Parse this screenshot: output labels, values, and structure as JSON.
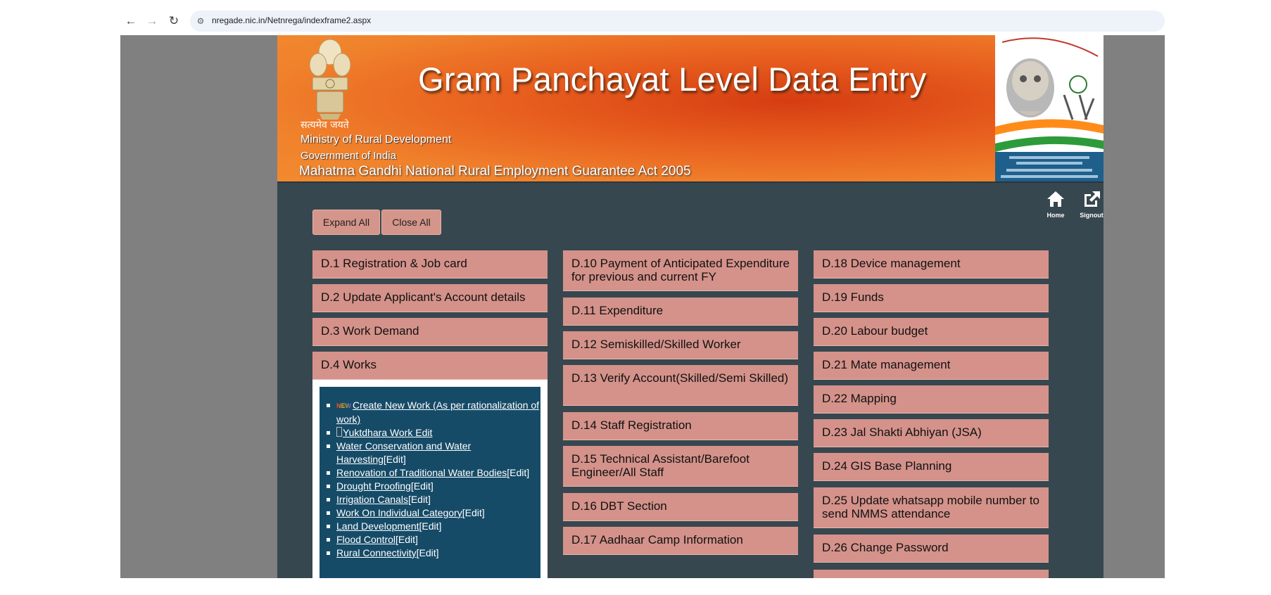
{
  "browser": {
    "url": "nregade.nic.in/Netnrega/indexframe2.aspx"
  },
  "banner": {
    "title": "Gram Panchayat Level Data Entry",
    "emblem_motto": "सत्यमेव जयते",
    "ministry": "Ministry of Rural Development",
    "government": "Government of India",
    "act": "Mahatma Gandhi National Rural Employment Guarantee Act 2005"
  },
  "toolbar": {
    "home_label": "Home",
    "signout_label": "Signout",
    "expand_all": "Expand All",
    "close_all": "Close All"
  },
  "menu": {
    "col1": [
      "D.1 Registration & Job card",
      "D.2 Update Applicant's Account details",
      "D.3 Work Demand",
      "D.4 Works"
    ],
    "col2": [
      "D.10 Payment of Anticipated Expenditure for previous and current FY",
      "D.11 Expenditure",
      "D.12 Semiskilled/Skilled Worker",
      "D.13 Verify Account(Skilled/Semi Skilled)",
      "D.14 Staff Registration",
      "D.15 Technical Assistant/Barefoot Engineer/All Staff",
      "D.16 DBT Section",
      "D.17 Aadhaar Camp Information"
    ],
    "col3": [
      "D.18 Device management",
      "D.19 Funds",
      "D.20 Labour budget",
      "D.21 Mate management",
      "D.22 Mapping",
      "D.23 Jal Shakti Abhiyan (JSA)",
      "D.24 GIS Base Planning",
      "D.25 Update whatsapp mobile number to send NMMS attendance",
      "D.26 Change Password"
    ]
  },
  "works_submenu": {
    "new_badge": "NEW",
    "create_new_work": "Create New Work (As per rationalization of work)",
    "yuktdhara": "Yuktdhara Work Edit",
    "edit_label": "[Edit]",
    "items": [
      "Water Conservation and Water Harvesting",
      "Renovation of Traditional Water Bodies",
      "Drought Proofing",
      "Irrigation Canals",
      "Work On Individual Category",
      "Land Development",
      "Flood Control",
      "Rural Connectivity"
    ]
  }
}
